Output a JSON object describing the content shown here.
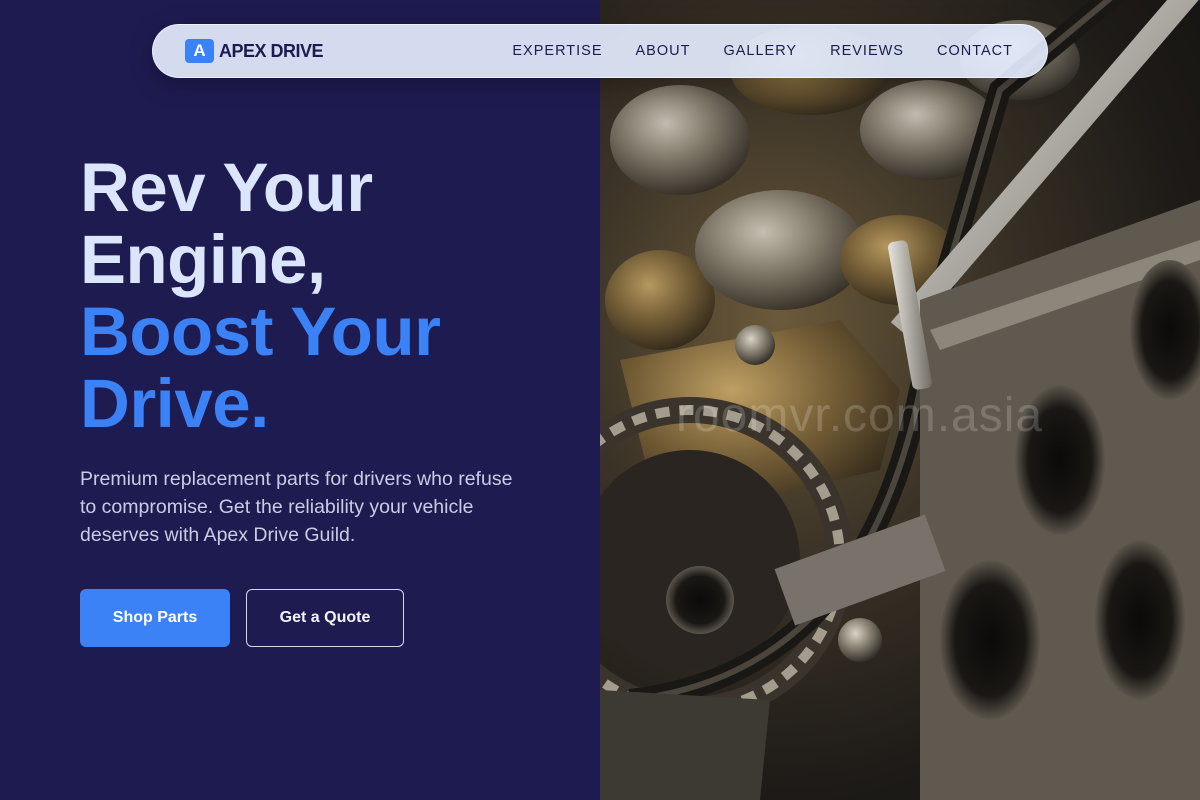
{
  "brand": {
    "mark": "A",
    "name": "APEX DRIVE"
  },
  "nav": {
    "links": [
      "EXPERTISE",
      "ABOUT",
      "GALLERY",
      "REVIEWS",
      "CONTACT"
    ]
  },
  "hero": {
    "headline_line1": "Rev Your",
    "headline_line2": "Engine,",
    "headline_line3": "Boost Your",
    "headline_line4": "Drive.",
    "subtitle": "Premium replacement parts for drivers who refuse to compromise. Get the reliability your vehicle deserves with Apex Drive Guild.",
    "primary_cta": "Shop Parts",
    "secondary_cta": "Get a Quote"
  },
  "image": {
    "subject": "engine-photo",
    "watermark": "roomvr.com.asia"
  },
  "colors": {
    "background": "#1e1b50",
    "accent": "#3b82f6",
    "headline_light": "#dbe6fd",
    "nav_bg": "#e2eafc"
  }
}
